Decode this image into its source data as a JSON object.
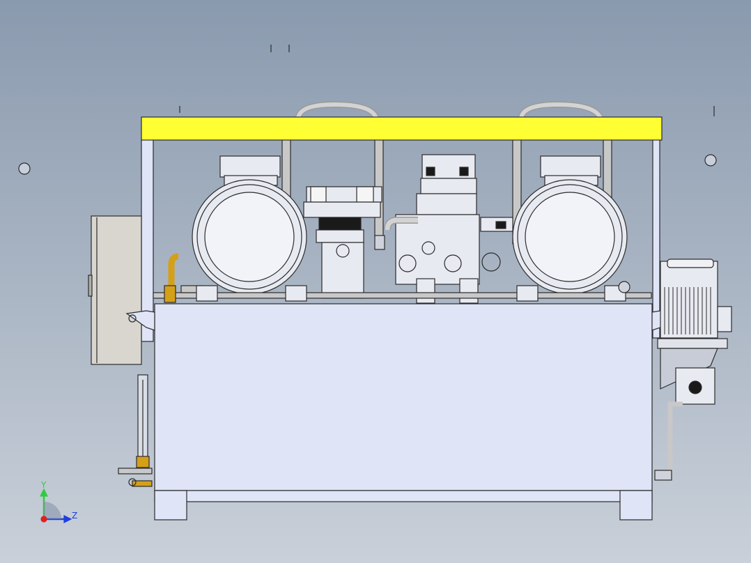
{
  "view": {
    "background_top": "#8a9aae",
    "background_bottom": "#c9d0d9",
    "edge_color": "#2b2b2b"
  },
  "assembly": {
    "frame_top_color": "#ffff33",
    "tank_color": "#dfe4f7",
    "motor_color": "#e8eaf2",
    "cabinet_color": "#d8d6cf",
    "brass_color": "#d4a017",
    "pipe_color": "#c8c8c8",
    "valve_marker_color": "#1a1a1a"
  },
  "triad": {
    "y_label": "Y",
    "z_label": "Z",
    "y_color": "#2ecc40",
    "z_color": "#1f3fe0",
    "x_color": "#e0201f"
  }
}
